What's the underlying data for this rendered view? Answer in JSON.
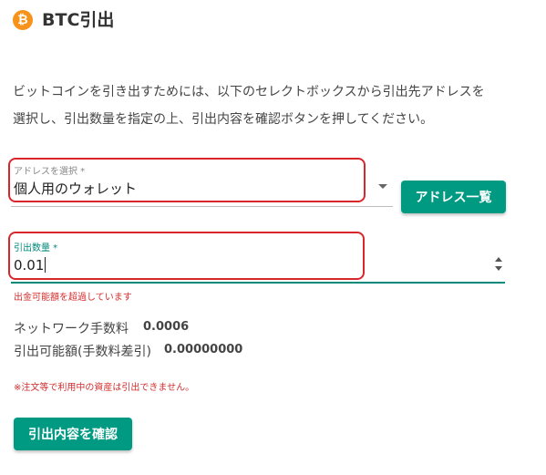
{
  "header": {
    "icon_glyph": "₿",
    "title": "BTC引出",
    "icon_name": "bitcoin-icon"
  },
  "description": {
    "line1": "ビットコインを引き出すためには、以下のセレクトボックスから引出先アドレスを",
    "line2": "選択し、引出数量を指定の上、引出内容を確認ボタンを押してください。"
  },
  "address_select": {
    "label": "アドレスを選択 *",
    "value": "個人用のウォレット"
  },
  "address_list_button": "アドレス一覧",
  "quantity": {
    "label": "引出数量 *",
    "value": "0.01",
    "error": "出金可能額を超過しています"
  },
  "fees": {
    "network_fee_label": "ネットワーク手数料",
    "network_fee_value": "0.0006",
    "available_label": "引出可能額(手数料差引)",
    "available_value": "0.00000000"
  },
  "note": "※注文等で利用中の資産は引出できません。",
  "confirm_button": "引出内容を確認",
  "colors": {
    "accent": "#009a82",
    "bitcoin": "#f7931a",
    "error": "#d32f2f",
    "highlight": "#d9262b"
  }
}
